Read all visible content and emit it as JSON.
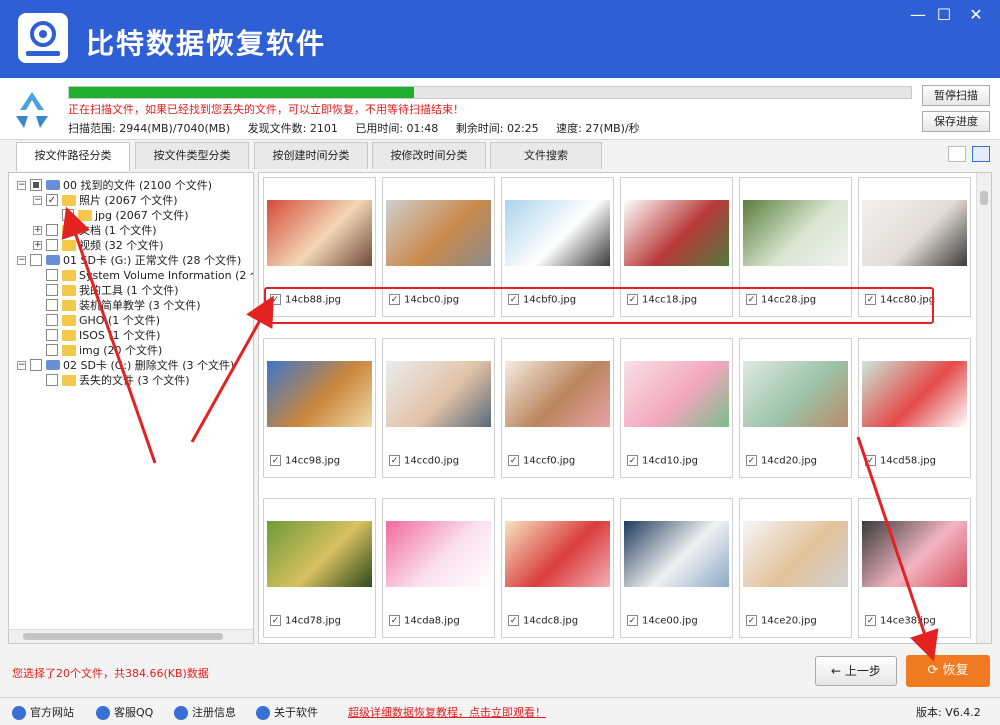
{
  "app": {
    "title": "比特数据恢复软件",
    "window_controls": [
      "minimize-icon",
      "maximize-icon",
      "close-icon"
    ]
  },
  "scan": {
    "progress": 0.41,
    "message": "正在扫描文件，如果已经找到您丢失的文件，可以立即恢复，不用等待扫描结束！",
    "range": "扫描范围: 2944(MB)/7040(MB)",
    "found": "发现文件数: 2101",
    "elapsed": "已用时间: 01:48",
    "remaining": "剩余时间: 02:25",
    "speed": "速度: 27(MB)/秒",
    "pause_label": "暂停扫描",
    "save_label": "保存进度"
  },
  "tabs": [
    "按文件路径分类",
    "按文件类型分类",
    "按创建时间分类",
    "按修改时间分类",
    "文件搜索"
  ],
  "tree": [
    {
      "label": "00 找到的文件   (2100 个文件)",
      "type": "drive",
      "expanded": true,
      "check": "partial"
    },
    {
      "label": "照片     (2067 个文件)",
      "type": "folder",
      "expanded": true,
      "check": "checked"
    },
    {
      "label": "jpg   (2067 个文件)",
      "type": "folder",
      "check": "checked"
    },
    {
      "label": "文档     (1 个文件)",
      "type": "folder",
      "expanded": false,
      "check": "none"
    },
    {
      "label": "视频     (32 个文件)",
      "type": "folder",
      "expanded": false,
      "check": "none"
    },
    {
      "label": "01 SD卡 (G:) 正常文件 (28 个文件)",
      "type": "drive",
      "expanded": true,
      "check": "none"
    },
    {
      "label": "System Volume Information   (2 个文",
      "type": "folder",
      "check": "none"
    },
    {
      "label": "我的工具     (1 个文件)",
      "type": "folder",
      "check": "none"
    },
    {
      "label": "装机简单教学     (3 个文件)",
      "type": "folder",
      "check": "none"
    },
    {
      "label": "GHO     (1 个文件)",
      "type": "folder",
      "check": "none"
    },
    {
      "label": "ISOS     (1 个文件)",
      "type": "folder",
      "check": "none"
    },
    {
      "label": "img     (20 个文件)",
      "type": "folder",
      "check": "none"
    },
    {
      "label": "02 SD卡 (G:) 删除文件 (3 个文件)",
      "type": "drive",
      "expanded": true,
      "check": "none"
    },
    {
      "label": "丢失的文件     (3 个文件)",
      "type": "folder",
      "check": "none"
    }
  ],
  "files": [
    {
      "name": "14cb88.jpg",
      "checked": true,
      "palette": [
        "#d64a3a",
        "#f2d7b5",
        "#6f4a3a"
      ]
    },
    {
      "name": "14cbc0.jpg",
      "checked": true,
      "palette": [
        "#cfcfcf",
        "#c98a4c",
        "#8b8b8b"
      ]
    },
    {
      "name": "14cbf0.jpg",
      "checked": true,
      "palette": [
        "#a9d4ec",
        "#ffffff",
        "#3b3b3b"
      ]
    },
    {
      "name": "14cc18.jpg",
      "checked": true,
      "palette": [
        "#ffffff",
        "#b83a3a",
        "#4c7a3c"
      ]
    },
    {
      "name": "14cc28.jpg",
      "checked": true,
      "palette": [
        "#5a7d3c",
        "#d8e5d0",
        "#f0f0f0"
      ]
    },
    {
      "name": "14cc80.jpg",
      "checked": true,
      "palette": [
        "#f1f1f1",
        "#e3ddd6",
        "#3a3a3a"
      ]
    },
    {
      "name": "14cc98.jpg",
      "checked": true,
      "palette": [
        "#3f76c8",
        "#c9883c",
        "#f1d9a8"
      ]
    },
    {
      "name": "14ccd0.jpg",
      "checked": true,
      "palette": [
        "#e9ecef",
        "#e3c3a8",
        "#5a6a7a"
      ]
    },
    {
      "name": "14ccf0.jpg",
      "checked": true,
      "palette": [
        "#f6ece2",
        "#b9865c",
        "#e9a2a6"
      ]
    },
    {
      "name": "14cd10.jpg",
      "checked": true,
      "palette": [
        "#f7e1e6",
        "#f3a7c0",
        "#7bbd8a"
      ]
    },
    {
      "name": "14cd20.jpg",
      "checked": true,
      "palette": [
        "#dfe9e2",
        "#9cc3a8",
        "#b98b6a"
      ]
    },
    {
      "name": "14cd58.jpg",
      "checked": true,
      "palette": [
        "#c9e8d9",
        "#e34a4a",
        "#ffffff"
      ]
    },
    {
      "name": "14cd78.jpg",
      "checked": true,
      "palette": [
        "#6c9b3a",
        "#d8c060",
        "#2d4a1c"
      ]
    },
    {
      "name": "14cda8.jpg",
      "checked": true,
      "palette": [
        "#f26a9c",
        "#fbe0ec",
        "#ffffff"
      ]
    },
    {
      "name": "14cdc8.jpg",
      "checked": true,
      "palette": [
        "#f6e5c2",
        "#d93c3c",
        "#f3b0b8"
      ]
    },
    {
      "name": "14ce00.jpg",
      "checked": true,
      "palette": [
        "#1e3a5e",
        "#f1f1f1",
        "#8ca9c8"
      ]
    },
    {
      "name": "14ce20.jpg",
      "checked": true,
      "palette": [
        "#f6f6f6",
        "#e3c29a",
        "#d0d0d0"
      ]
    },
    {
      "name": "14ce38.jpg",
      "checked": true,
      "palette": [
        "#3a3a3a",
        "#f2b5c2",
        "#d94c5c"
      ]
    }
  ],
  "selection_info": "您选择了20个文件，共384.66(KB)数据",
  "buttons": {
    "back": "上一步",
    "recover": "恢复"
  },
  "footer": {
    "official_site": "官方网站",
    "support_qq": "客服QQ",
    "register": "注册信息",
    "about": "关于软件",
    "tutorial_link": "超级详细数据恢复教程，点击立即观看！",
    "version": "版本: V6.4.2"
  },
  "colors": {
    "title_bar": "#2f5fd4",
    "progress": "#1fae2e",
    "warning_text": "#e02020",
    "recover_button": "#f07a20",
    "annotation": "#e32222"
  }
}
